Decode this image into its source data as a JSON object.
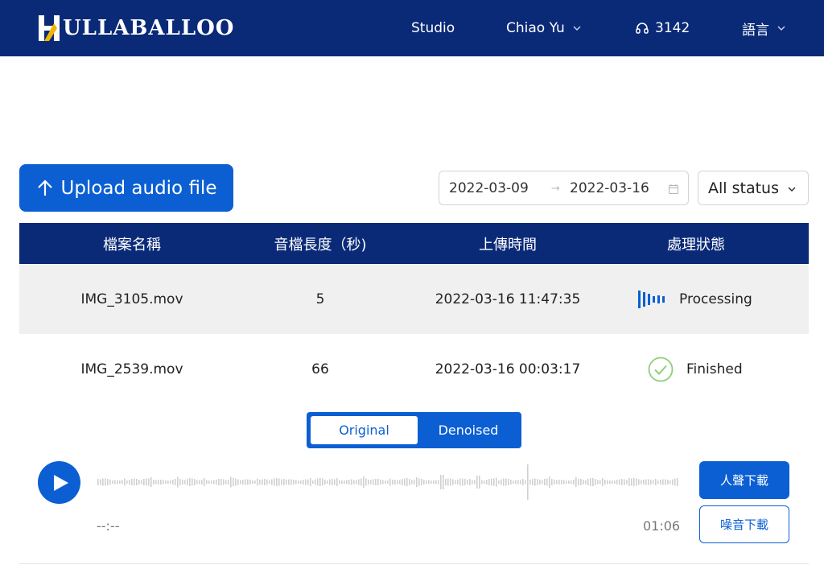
{
  "header": {
    "logo_text": "ULLABALLOO",
    "nav": {
      "studio": "Studio",
      "user": "Chiao Yu",
      "credits": "3142",
      "language": "語言"
    }
  },
  "toolbar": {
    "upload_label": "Upload audio file",
    "date_start": "2022-03-09",
    "date_sep": "→",
    "date_end": "2022-03-16",
    "status_filter": "All status"
  },
  "table": {
    "columns": [
      "檔案名稱",
      "音檔長度（秒)",
      "上傳時間",
      "處理狀態"
    ],
    "rows": [
      {
        "file": "IMG_3105.mov",
        "duration": "5",
        "uploaded": "2022-03-16 11:47:35",
        "status": "Processing",
        "status_icon": "waveform-icon"
      },
      {
        "file": "IMG_2539.mov",
        "duration": "66",
        "uploaded": "2022-03-16 00:03:17",
        "status": "Finished",
        "status_icon": "check-circle-icon"
      }
    ]
  },
  "player": {
    "toggle_original": "Original",
    "toggle_denoised": "Denoised",
    "time_current": "--:--",
    "time_total": "01:06",
    "download_voice": "人聲下載",
    "download_noise": "噪音下載"
  },
  "colors": {
    "brand_navy": "#0a2a78",
    "accent_blue": "#0b5fd3",
    "success_green": "#8fce7a",
    "row_highlight": "#f0f0f0"
  }
}
